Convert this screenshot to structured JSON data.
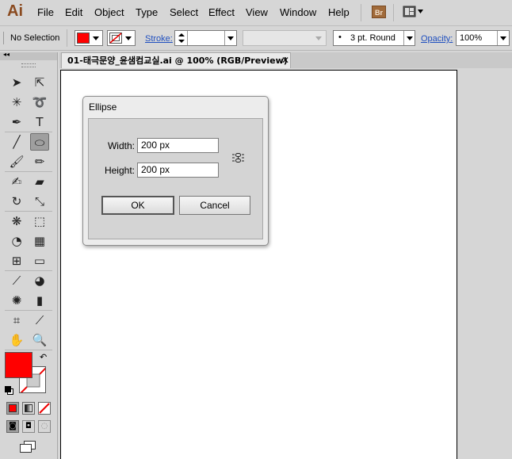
{
  "app": {
    "logo": "Ai",
    "bridge_label": "Br"
  },
  "menu": [
    "File",
    "Edit",
    "Object",
    "Type",
    "Select",
    "Effect",
    "View",
    "Window",
    "Help"
  ],
  "control_bar": {
    "selection_status": "No Selection",
    "fill_color": "#ff0000",
    "stroke_label": "Stroke:",
    "stroke_weight_value": "",
    "brush_value": "3 pt. Round",
    "brush_bullet": "•",
    "opacity_label": "Opacity:",
    "opacity_value": "100%"
  },
  "document_tab": {
    "title": "01-태극문양_윤샘컴교실.ai @ 100% (RGB/Preview)",
    "close_glyph": "✕"
  },
  "toolbox": {
    "collapse_glyph": "◂◂",
    "tools": [
      {
        "name": "selection-tool-icon",
        "glyph": "➤"
      },
      {
        "name": "direct-selection-tool-icon",
        "glyph": "⇱"
      },
      {
        "name": "magic-wand-tool-icon",
        "glyph": "✳"
      },
      {
        "name": "lasso-tool-icon",
        "glyph": "➰"
      },
      {
        "name": "pen-tool-icon",
        "glyph": "✒"
      },
      {
        "name": "type-tool-icon",
        "glyph": "T"
      },
      {
        "name": "line-segment-tool-icon",
        "glyph": "╱"
      },
      {
        "name": "ellipse-tool-icon",
        "glyph": "⬭"
      },
      {
        "name": "paintbrush-tool-icon",
        "glyph": "🖌"
      },
      {
        "name": "pencil-tool-icon",
        "glyph": "✏"
      },
      {
        "name": "blob-brush-tool-icon",
        "glyph": "✍"
      },
      {
        "name": "eraser-tool-icon",
        "glyph": "▰"
      },
      {
        "name": "rotate-tool-icon",
        "glyph": "↻"
      },
      {
        "name": "scale-tool-icon",
        "glyph": "⤡"
      },
      {
        "name": "warp-tool-icon",
        "glyph": "❋"
      },
      {
        "name": "free-transform-tool-icon",
        "glyph": "⬚"
      },
      {
        "name": "shape-builder-tool-icon",
        "glyph": "◔"
      },
      {
        "name": "perspective-grid-tool-icon",
        "glyph": "▦"
      },
      {
        "name": "mesh-tool-icon",
        "glyph": "⊞"
      },
      {
        "name": "gradient-tool-icon",
        "glyph": "▭"
      },
      {
        "name": "eyedropper-tool-icon",
        "glyph": "⟋"
      },
      {
        "name": "blend-tool-icon",
        "glyph": "◕"
      },
      {
        "name": "symbol-sprayer-tool-icon",
        "glyph": "✺"
      },
      {
        "name": "column-graph-tool-icon",
        "glyph": "▮"
      },
      {
        "name": "artboard-tool-icon",
        "glyph": "⌗"
      },
      {
        "name": "slice-tool-icon",
        "glyph": "⟋"
      },
      {
        "name": "hand-tool-icon",
        "glyph": "✋"
      },
      {
        "name": "zoom-tool-icon",
        "glyph": "🔍"
      }
    ],
    "fill_color": "#ff0000",
    "stroke_color": "none",
    "swap_glyph": "↶"
  },
  "ellipse_dialog": {
    "title": "Ellipse",
    "width_label": "Width:",
    "width_value": "200 px",
    "height_label": "Height:",
    "height_value": "200 px",
    "ok_label": "OK",
    "cancel_label": "Cancel"
  }
}
